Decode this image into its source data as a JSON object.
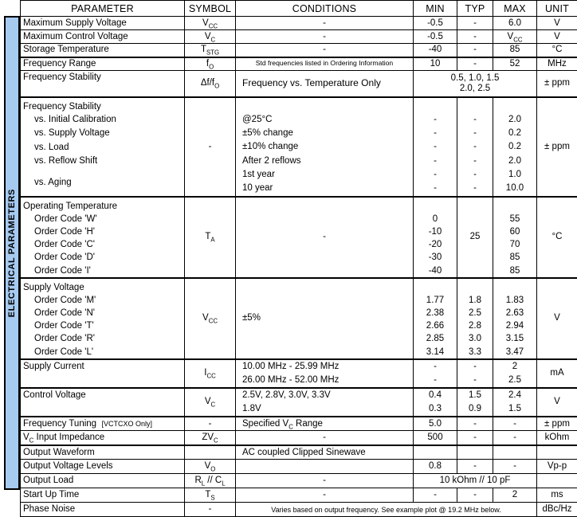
{
  "section_label": "ELECTRICAL PARAMETERS",
  "colors": {
    "header_blue": "#A6CAF0",
    "border": "#000000",
    "background": "#FFFFFF"
  },
  "table": {
    "headers": [
      "PARAMETER",
      "SYMBOL",
      "CONDITIONS",
      "MIN",
      "TYP",
      "MAX",
      "UNIT"
    ],
    "rows": {
      "max_supply_voltage": {
        "parameter": "Maximum Supply Voltage",
        "symbol_base": "V",
        "symbol_sub": "CC",
        "conditions": "-",
        "min": "-0.5",
        "typ": "-",
        "max": "6.0",
        "unit": "V"
      },
      "max_control_voltage": {
        "parameter": "Maximum Control Voltage",
        "symbol_base": "V",
        "symbol_sub": "C",
        "conditions": "-",
        "min": "-0.5",
        "typ": "-",
        "max_base": "V",
        "max_sub": "CC",
        "unit": "V"
      },
      "storage_temperature": {
        "parameter": "Storage Temperature",
        "symbol_base": "T",
        "symbol_sub": "STG",
        "conditions": "-",
        "min": "-40",
        "typ": "-",
        "max": "85",
        "unit": "°C"
      },
      "frequency_range": {
        "parameter": "Frequency Range",
        "symbol_base": "f",
        "symbol_sub": "O",
        "conditions": "Std frequencies listed in Ordering Information",
        "min": "10",
        "typ": "-",
        "max": "52",
        "unit": "MHz"
      },
      "frequency_stability_temp": {
        "parameter": "Frequency Stability",
        "symbol": "Δf/f",
        "symbol_sub": "O",
        "conditions": "Frequency vs. Temperature Only",
        "value_line1": "0.5, 1.0, 1.5",
        "value_line2": "2.0, 2.5",
        "unit": "± ppm"
      },
      "frequency_stability_group": {
        "title": "Frequency Stability",
        "symbol": "-",
        "unit": "± ppm",
        "items": [
          {
            "parameter": "vs. Initial Calibration",
            "conditions": "@25°C",
            "min": "-",
            "typ": "-",
            "max": "2.0"
          },
          {
            "parameter": "vs. Supply Voltage",
            "conditions": "±5% change",
            "min": "-",
            "typ": "-",
            "max": "0.2"
          },
          {
            "parameter": "vs. Load",
            "conditions": "±10% change",
            "min": "-",
            "typ": "-",
            "max": "0.2"
          },
          {
            "parameter": "vs. Reflow Shift",
            "conditions": "After 2 reflows",
            "min": "-",
            "typ": "-",
            "max": "2.0"
          },
          {
            "parameter": "vs. Aging",
            "conditions": "1st year",
            "min": "-",
            "typ": "-",
            "max": "1.0"
          },
          {
            "parameter": "",
            "conditions": "10 year",
            "min": "-",
            "typ": "-",
            "max": "10.0"
          }
        ]
      },
      "operating_temperature": {
        "title": "Operating Temperature",
        "symbol_base": "T",
        "symbol_sub": "A",
        "conditions": "-",
        "typ": "25",
        "unit": "°C",
        "items": [
          {
            "parameter": "Order Code 'W'",
            "min": "0",
            "max": "55"
          },
          {
            "parameter": "Order Code 'H'",
            "min": "-10",
            "max": "60"
          },
          {
            "parameter": "Order Code 'C'",
            "min": "-20",
            "max": "70"
          },
          {
            "parameter": "Order Code 'D'",
            "min": "-30",
            "max": "85"
          },
          {
            "parameter": "Order Code 'I'",
            "min": "-40",
            "max": "85"
          }
        ]
      },
      "supply_voltage": {
        "title": "Supply Voltage",
        "symbol_base": "V",
        "symbol_sub": "CC",
        "conditions": "±5%",
        "unit": "V",
        "items": [
          {
            "parameter": "Order Code 'M'",
            "min": "1.77",
            "typ": "1.8",
            "max": "1.83"
          },
          {
            "parameter": "Order Code 'N'",
            "min": "2.38",
            "typ": "2.5",
            "max": "2.63"
          },
          {
            "parameter": "Order Code 'T'",
            "min": "2.66",
            "typ": "2.8",
            "max": "2.94"
          },
          {
            "parameter": "Order Code 'R'",
            "min": "2.85",
            "typ": "3.0",
            "max": "3.15"
          },
          {
            "parameter": "Order Code 'L'",
            "min": "3.14",
            "typ": "3.3",
            "max": "3.47"
          }
        ]
      },
      "supply_current": {
        "parameter": "Supply Current",
        "symbol_base": "I",
        "symbol_sub": "CC",
        "unit": "mA",
        "lines": [
          {
            "conditions": "10.00 MHz - 25.99 MHz",
            "min": "-",
            "typ": "-",
            "max": "2"
          },
          {
            "conditions": "26.00 MHz - 52.00 MHz",
            "min": "-",
            "typ": "-",
            "max": "2.5"
          }
        ]
      },
      "control_voltage": {
        "parameter": "Control Voltage",
        "symbol_base": "V",
        "symbol_sub": "C",
        "unit": "V",
        "lines": [
          {
            "conditions": "2.5V, 2.8V, 3.0V, 3.3V",
            "min": "0.4",
            "typ": "1.5",
            "max": "2.4"
          },
          {
            "conditions": "1.8V",
            "min": "0.3",
            "typ": "0.9",
            "max": "1.5"
          }
        ]
      },
      "frequency_tuning": {
        "parameter": "Frequency Tuning",
        "parameter_note": "[VCTCXO Only]",
        "symbol": "-",
        "conditions_pre": "Specified V",
        "conditions_sub": "C",
        "conditions_post": " Range",
        "min": "5.0",
        "typ": "-",
        "max": "-",
        "unit": "± ppm"
      },
      "vc_input_impedance": {
        "parameter_pre": "V",
        "parameter_sub": "C",
        "parameter_post": " Input Impedance",
        "symbol_base": "ZV",
        "symbol_sub": "C",
        "conditions": "-",
        "min": "500",
        "typ": "-",
        "max": "-",
        "unit": "kOhm"
      },
      "output_waveform": {
        "parameter": "Output Waveform",
        "symbol": "",
        "conditions": "AC coupled Clipped Sinewave",
        "min": "",
        "typ": "",
        "max": "",
        "unit": ""
      },
      "output_voltage_levels": {
        "parameter": "Output Voltage Levels",
        "symbol_base": "V",
        "symbol_sub": "O",
        "conditions": "",
        "min": "0.8",
        "typ": "-",
        "max": "-",
        "unit": "Vp-p"
      },
      "output_load": {
        "parameter": "Output Load",
        "symbol_r": "R",
        "symbol_r_sub": "L",
        "symbol_sep": " // ",
        "symbol_c": "C",
        "symbol_c_sub": "L",
        "conditions": "-",
        "value": "10 kOhm // 10 pF",
        "unit": ""
      },
      "start_up_time": {
        "parameter": "Start Up Time",
        "symbol_base": "T",
        "symbol_sub": "S",
        "conditions": "-",
        "min": "-",
        "typ": "-",
        "max": "2",
        "unit": "ms"
      },
      "phase_noise": {
        "parameter": "Phase Noise",
        "symbol": "-",
        "conditions": "Varies based on output frequency.  See example plot @ 19.2 MHz below.",
        "unit": "dBc/Hz"
      }
    }
  }
}
